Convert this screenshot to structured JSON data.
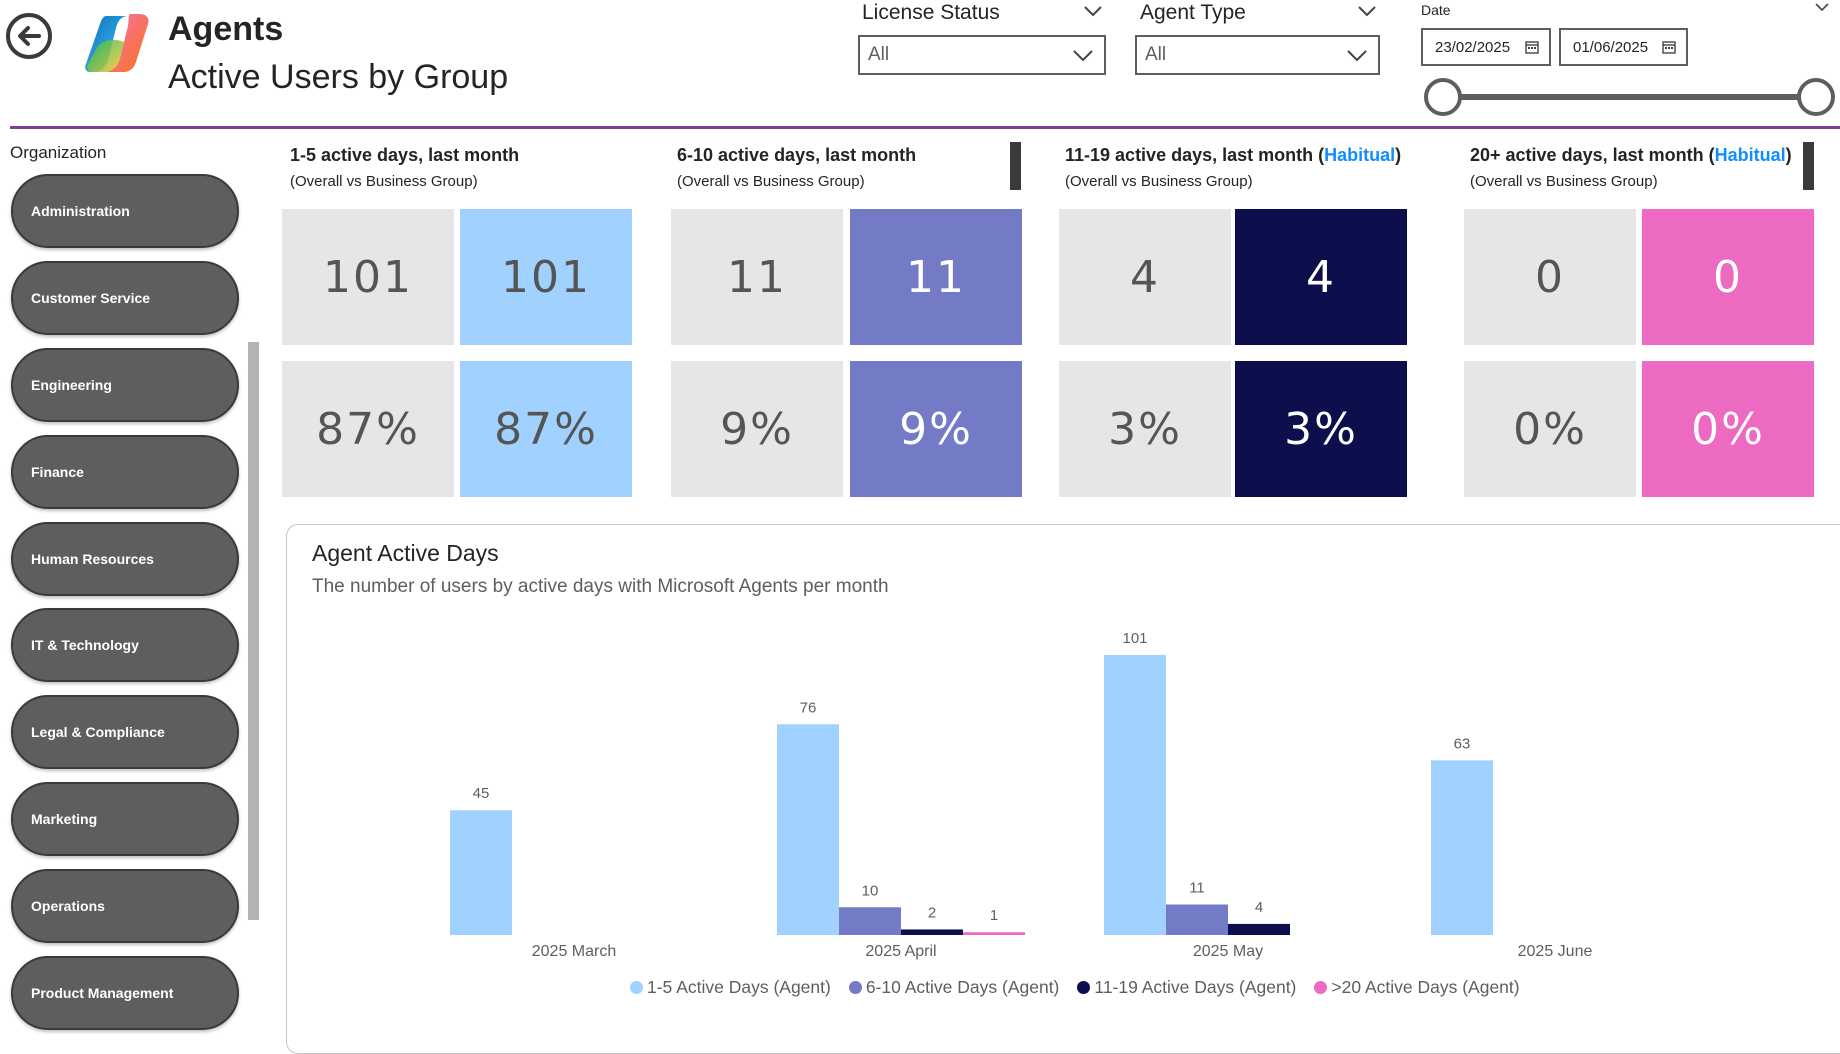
{
  "header": {
    "back_icon": "arrow-left-circle-icon",
    "logo_icon": "copilot-logo-icon",
    "title": "Agents",
    "subtitle": "Active Users by Group"
  },
  "filters": {
    "license_status": {
      "label": "License Status",
      "value": "All"
    },
    "agent_type": {
      "label": "Agent Type",
      "value": "All"
    },
    "date": {
      "label": "Date",
      "start": "23/02/2025",
      "end": "01/06/2025",
      "range_selected_fraction": [
        0.0,
        1.0
      ]
    }
  },
  "sidebar": {
    "label": "Organization",
    "items": [
      "Administration",
      "Customer Service",
      "Engineering",
      "Finance",
      "Human Resources",
      "IT & Technology",
      "Legal & Compliance",
      "Marketing",
      "Operations",
      "Product Management"
    ]
  },
  "kpis": [
    {
      "title": "1-5 active days, last month",
      "highlight": "",
      "subtitle": "(Overall vs Business Group)",
      "overall_count": "101",
      "group_count": "101",
      "overall_pct": "87%",
      "group_pct": "87%",
      "color": "#a0d1ff",
      "text_color": "#555555"
    },
    {
      "title": "6-10 active days, last month",
      "highlight": "",
      "subtitle": "(Overall vs Business Group)",
      "overall_count": "11",
      "group_count": "11",
      "overall_pct": "9%",
      "group_pct": "9%",
      "color": "#737bc6",
      "text_color": "#ffffff"
    },
    {
      "title": "11-19 active days, last month (",
      "highlight": "Habitual",
      "title_end": ")",
      "subtitle": "(Overall vs Business Group)",
      "overall_count": "4",
      "group_count": "4",
      "overall_pct": "3%",
      "group_pct": "3%",
      "color": "#0c0f4c",
      "text_color": "#ffffff"
    },
    {
      "title": "20+ active days, last month (",
      "highlight": "Habitual",
      "title_end": ")",
      "subtitle": "(Overall vs Business Group)",
      "overall_count": "0",
      "group_count": "0",
      "overall_pct": "0%",
      "group_pct": "0%",
      "color": "#ec6ac1",
      "text_color": "#ffffff"
    }
  ],
  "chart": {
    "title": "Agent Active Days",
    "subtitle": "The number of users by active days with Microsoft Agents per month"
  },
  "chart_data": {
    "type": "bar",
    "categories": [
      "2025 March",
      "2025 April",
      "2025 May",
      "2025 June"
    ],
    "series": [
      {
        "name": "1-5 Active Days (Agent)",
        "color": "#a0d1ff",
        "values": [
          45,
          76,
          101,
          63
        ]
      },
      {
        "name": "6-10 Active Days (Agent)",
        "color": "#737bc6",
        "values": [
          null,
          10,
          11,
          null
        ]
      },
      {
        "name": "11-19 Active Days (Agent)",
        "color": "#0c0f4c",
        "values": [
          null,
          2,
          4,
          null
        ]
      },
      {
        "name": ">20 Active Days (Agent)",
        "color": "#ec6ac1",
        "values": [
          null,
          1,
          null,
          null
        ]
      }
    ],
    "ylim": [
      0,
      101
    ],
    "legend": "bottom-center",
    "grid": false
  }
}
